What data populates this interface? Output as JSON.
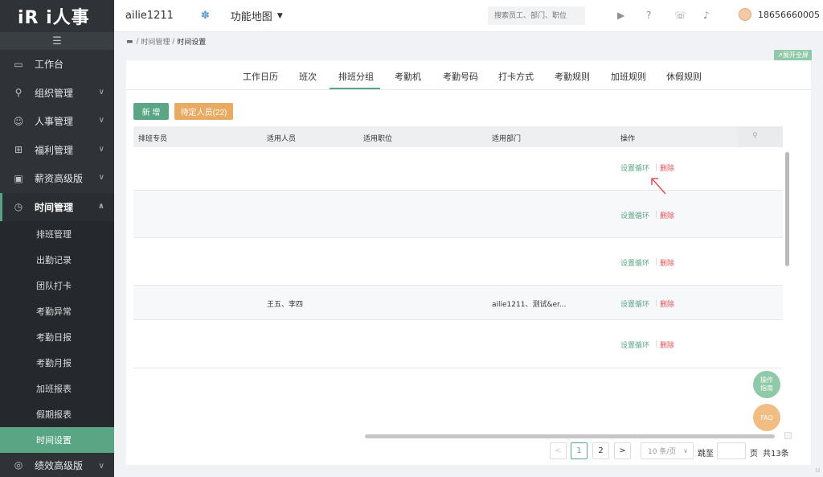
{
  "app": {
    "logo": "iR i人事"
  },
  "sidebar": {
    "collapse_glyph": "☰",
    "items": [
      {
        "label": "工作台",
        "icon": "monitor-icon",
        "glyph": "▭",
        "expandable": false
      },
      {
        "label": "组织管理",
        "icon": "org-icon",
        "glyph": "⚲",
        "expandable": true
      },
      {
        "label": "人事管理",
        "icon": "person-icon",
        "glyph": "☺",
        "expandable": true
      },
      {
        "label": "福利管理",
        "icon": "gift-icon",
        "glyph": "⊞",
        "expandable": true
      },
      {
        "label": "薪资高级版",
        "icon": "wallet-icon",
        "glyph": "▣",
        "expandable": true
      },
      {
        "label": "时间管理",
        "icon": "clock-icon",
        "glyph": "◷",
        "expandable": true,
        "open": true
      }
    ],
    "sub_items": [
      "排班管理",
      "出勤记录",
      "团队打卡",
      "考勤异常",
      "考勤日报",
      "考勤月报",
      "加班报表",
      "假期报表",
      "时间设置"
    ],
    "active_sub": "时间设置",
    "bottom_item": {
      "label": "绩效高级版",
      "icon": "target-icon",
      "glyph": "◎"
    }
  },
  "topbar": {
    "company": "ailie1211",
    "gear_glyph": "✽",
    "function_map": "功能地图",
    "search_placeholder": "搜索员工、部门、职位",
    "phone": "18656660005"
  },
  "breadcrumb": {
    "icon_glyph": "▬",
    "parent": "时间管理",
    "current": "时间设置"
  },
  "expand_button": "展开全屏",
  "tabs": {
    "items": [
      "工作日历",
      "班次",
      "排班分组",
      "考勤机",
      "考勤号码",
      "打卡方式",
      "考勤规则",
      "加班规则",
      "休假规则"
    ],
    "active": "排班分组"
  },
  "actions": {
    "new_label": "新 增",
    "pending_label": "待定人员(22)"
  },
  "table": {
    "columns": [
      "排班专员",
      "适用人员",
      "适用职位",
      "适用部门",
      "操作"
    ],
    "rows": [
      {
        "specialist": "",
        "people": "",
        "position": "",
        "department": "",
        "op_set": "设置循环",
        "op_delete": "删除"
      },
      {
        "specialist": "",
        "people": "",
        "position": "",
        "department": "",
        "op_set": "设置循环",
        "op_delete": "删除"
      },
      {
        "specialist": "",
        "people": "",
        "position": "",
        "department": "",
        "op_set": "设置循环",
        "op_delete": "删除"
      },
      {
        "specialist": "",
        "people": "王五、李四",
        "position": "",
        "department": "ailie1211、测试&er...",
        "op_set": "设置循环",
        "op_delete": "删除"
      },
      {
        "specialist": "",
        "people": "",
        "position": "",
        "department": "",
        "op_set": "设置循环",
        "op_delete": "删除"
      }
    ]
  },
  "floating": {
    "guide_line1": "操作",
    "guide_line2": "指南",
    "faq": "FAQ"
  },
  "pagination": {
    "prev": "<",
    "pages": [
      "1",
      "2"
    ],
    "current": "1",
    "next": ">",
    "page_size": "10 条/页",
    "jump_label": "跳至",
    "page_suffix": "页",
    "total": "共13条"
  },
  "colors": {
    "accent": "#5aa584",
    "danger": "#e0525a",
    "sidebar": "#2f3337",
    "pending": "#e9aa64"
  }
}
